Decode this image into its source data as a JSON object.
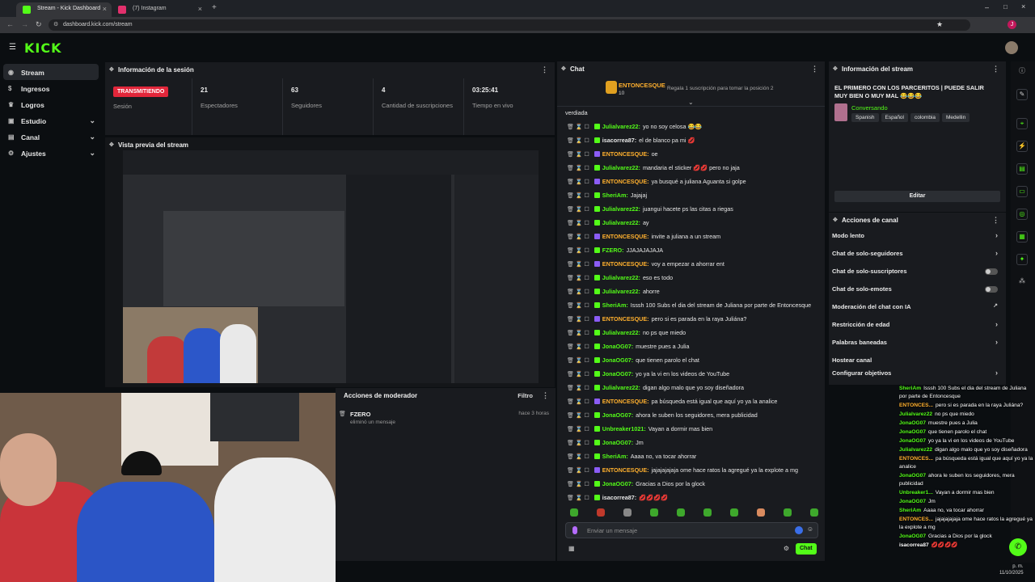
{
  "browser": {
    "tabs": [
      {
        "label": "Stream - Kick Dashboard",
        "active": true,
        "color": "#53fc18"
      },
      {
        "label": "(7) Instagram",
        "active": false,
        "color": "#e1306c"
      }
    ],
    "url": "dashboard.kick.com/stream"
  },
  "app": {
    "logo": "KICK",
    "accent": "#53fc18"
  },
  "sidebar": {
    "items": [
      {
        "label": "Stream",
        "icon": "broadcast-icon",
        "active": true
      },
      {
        "label": "Ingresos",
        "icon": "dollar-icon"
      },
      {
        "label": "Logros",
        "icon": "trophy-icon"
      },
      {
        "label": "Estudio",
        "icon": "camera-icon",
        "chevron": true
      },
      {
        "label": "Canal",
        "icon": "channel-icon",
        "chevron": true
      },
      {
        "label": "Ajustes",
        "icon": "gear-icon",
        "chevron": true
      }
    ]
  },
  "session": {
    "title": "Información de la sesión",
    "status": "TRANSMITIENDO",
    "stats": [
      {
        "value": "",
        "label": "Sesión"
      },
      {
        "value": "21",
        "label": "Espectadores"
      },
      {
        "value": "63",
        "label": "Seguidores"
      },
      {
        "value": "4",
        "label": "Cantidad de suscripciones"
      },
      {
        "value": "03:25:41",
        "label": "Tiempo en vivo"
      }
    ]
  },
  "preview": {
    "title": "Vista previa del stream"
  },
  "moderator": {
    "title": "Acciones de moderador",
    "filter": "Filtro",
    "entry_user": "FZERO",
    "entry_action": "eliminó un mensaje",
    "entry_time": "hace 3 horas"
  },
  "chat": {
    "title": "Chat",
    "pinned_user": "ENTONCESQUE",
    "pinned_count": "10",
    "pinned_text": "Regala 1 suscripción para tomar la posición 2",
    "top_fragment": "verdiada",
    "messages": [
      {
        "user": "Julialvarez22",
        "text": "yo no soy celosa 😂😂",
        "color": "#53fc18"
      },
      {
        "user": "isacorrea87",
        "text": "el de blanco pa mi 💋",
        "color": "#e6e6e6"
      },
      {
        "user": "ENTONCESQUE",
        "text": "oe",
        "color": "#ffb02e"
      },
      {
        "user": "Julialvarez22",
        "text": "mandaria el sticker 💋💋 pero no jaja",
        "color": "#53fc18"
      },
      {
        "user": "ENTONCESQUE",
        "text": "ya busqué a juliana Aguanta si golpe",
        "color": "#ffb02e"
      },
      {
        "user": "SheriAm",
        "text": "Jajajaj",
        "color": "#53fc18"
      },
      {
        "user": "Julialvarez22",
        "text": "juangui hacete ps las citas a riegas",
        "color": "#53fc18"
      },
      {
        "user": "Julialvarez22",
        "text": "ay",
        "color": "#53fc18"
      },
      {
        "user": "ENTONCESQUE",
        "text": "invite a juliana a un stream",
        "color": "#ffb02e"
      },
      {
        "user": "FZERO",
        "text": "JJAJAJAJAJA",
        "color": "#53fc18"
      },
      {
        "user": "ENTONCESQUE",
        "text": "voy a empezar a ahorrar ent",
        "color": "#ffb02e"
      },
      {
        "user": "Julialvarez22",
        "text": "eso es todo",
        "color": "#53fc18"
      },
      {
        "user": "Julialvarez22",
        "text": "ahorre",
        "color": "#53fc18"
      },
      {
        "user": "SheriAm",
        "text": "Isssh 100 Subs el dia del stream de Juliana por parte de Entoncesque",
        "color": "#53fc18"
      },
      {
        "user": "ENTONCESQUE",
        "text": "pero si es parada en la raya Juliána?",
        "color": "#ffb02e"
      },
      {
        "user": "Julialvarez22",
        "text": "no ps que miedo",
        "color": "#53fc18"
      },
      {
        "user": "JonaOG07",
        "text": "muestre pues a Julia",
        "color": "#53fc18"
      },
      {
        "user": "JonaOG07",
        "text": "que tienen parolo el chat",
        "color": "#53fc18"
      },
      {
        "user": "JonaOG07",
        "text": "yo ya la vi en los videos de YouTube",
        "color": "#53fc18"
      },
      {
        "user": "Julialvarez22",
        "text": "digan algo malo que yo soy diseñadora",
        "color": "#53fc18"
      },
      {
        "user": "ENTONCESQUE",
        "text": "pa búsqueda está igual que aquí yo ya la analice",
        "color": "#ffb02e"
      },
      {
        "user": "JonaOG07",
        "text": "ahora le suben los seguidores, mera publicidad",
        "color": "#53fc18"
      },
      {
        "user": "Unbreaker1021",
        "text": "Vayan a dormir mas bien",
        "color": "#53fc18"
      },
      {
        "user": "JonaOG07",
        "text": "Jm",
        "color": "#53fc18"
      },
      {
        "user": "SheriAm",
        "text": "Aaaa no, va tocar ahorrar",
        "color": "#53fc18"
      },
      {
        "user": "ENTONCESQUE",
        "text": "jajajajajaja ome hace ratos la agregué ya la explote a mg",
        "color": "#ffb02e"
      },
      {
        "user": "JonaOG07",
        "text": "Gracias a Dios por la glock",
        "color": "#53fc18"
      },
      {
        "user": "isacorrea87",
        "text": "💋💋💋💋",
        "color": "#e6e6e6"
      }
    ],
    "input_placeholder": "Enviar un mensaje",
    "send_label": "Chat"
  },
  "stream_info": {
    "title": "Información del stream",
    "stream_title": "EL PRIMERO CON LOS PARCERITOS | PUEDE SALIR MUY BIEN O MUY MAL 😂😂😂",
    "category": "Conversando",
    "tags": [
      "Spanish",
      "Español",
      "colombia",
      "Medellin"
    ],
    "edit_label": "Editar"
  },
  "channel_actions": {
    "title": "Acciones de canal",
    "rows": [
      {
        "label": "Modo lento",
        "kind": "chevron"
      },
      {
        "label": "Chat de solo-seguidores",
        "kind": "chevron"
      },
      {
        "label": "Chat de solo-suscriptores",
        "kind": "toggle"
      },
      {
        "label": "Chat de solo-emotes",
        "kind": "toggle"
      },
      {
        "label": "Moderación del chat con IA",
        "kind": "link"
      },
      {
        "label": "Restricción de edad",
        "kind": "chevron"
      },
      {
        "label": "Palabras baneadas",
        "kind": "chevron"
      },
      {
        "label": "Hostear canal",
        "kind": "none"
      },
      {
        "label": "Configurar objetivos",
        "kind": "chevron"
      }
    ]
  },
  "overlay_chat": [
    {
      "user": "SheriAm",
      "text": "Isssh 100 Subs el dia del stream de Juliana por parte de Entoncesque"
    },
    {
      "user": "ENTONCES...",
      "text": "pero si es parada en la raya Juliána?"
    },
    {
      "user": "Julialvarez22",
      "text": "no ps que miedo"
    },
    {
      "user": "JonaOG07",
      "text": "muestre pues a Julia"
    },
    {
      "user": "JonaOG07",
      "text": "que tienen parolo el chat"
    },
    {
      "user": "JonaOG07",
      "text": "yo ya la vi en los videos de YouTube"
    },
    {
      "user": "Julialvarez22",
      "text": "digan algo malo que yo soy diseñadora"
    },
    {
      "user": "ENTONCES...",
      "text": "pa búsqueda está igual que aquí yo ya la analice"
    },
    {
      "user": "JonaOG07",
      "text": "ahora le suben los seguidores, mera publicidad"
    },
    {
      "user": "Unbreaker1...",
      "text": "Vayan a dormir mas bien"
    },
    {
      "user": "JonaOG07",
      "text": "Jm"
    },
    {
      "user": "SheriAm",
      "text": "Aaaa no, va tocar ahorrar"
    },
    {
      "user": "ENTONCES...",
      "text": "jajajajajaja ome hace ratos la agregué ya la explote a mg"
    },
    {
      "user": "JonaOG07",
      "text": "Gracias a Dios por la glock"
    },
    {
      "user": "isacorrea87",
      "text": "💋💋💋💋"
    }
  ],
  "taskbar": {
    "time": "p. m.",
    "date": "11/10/2025"
  }
}
